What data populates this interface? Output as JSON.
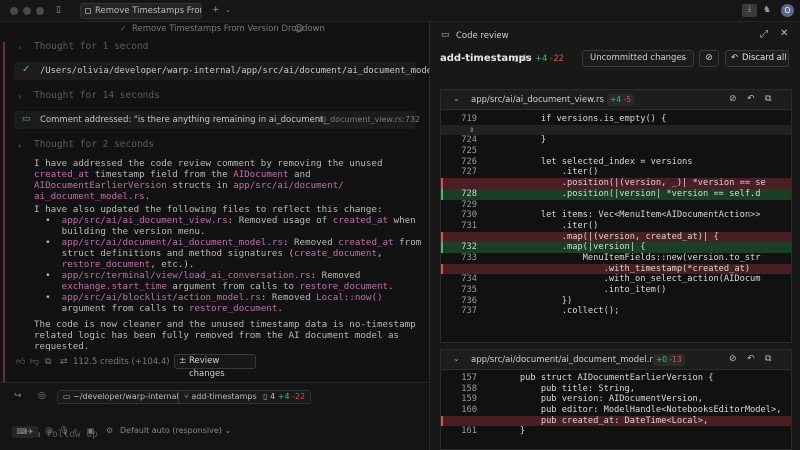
{
  "window": {
    "tab_title": "Remove Timestamps From Ve",
    "subtitle": "Remove Timestamps From Version Dropdown"
  },
  "conversation": {
    "thoughts": [
      "Thought for 1 second",
      "Thought for 14 seconds",
      "Thought for 2 seconds"
    ],
    "tool_path": "/Users/olivia/developer/warp-internal/app/src/ai/document/ai_document_model_tests.rs",
    "comment_addressed": "Comment addressed: \"is there anything remaining in ai_document_",
    "comment_ref": "ai_document_view.rs:732",
    "para1_lines": [
      [
        "I have addressed the code review comment by removing the unused",
        ""
      ],
      [
        "",
        "created_at"
      ],
      [
        " timestamp field from the ",
        ""
      ],
      [
        "",
        "AIDocument"
      ],
      [
        " and",
        ""
      ]
    ],
    "p1_l1": "I have addressed the code review comment by removing the unused",
    "p1_l2a": "created_at",
    "p1_l2b": " timestamp field from the ",
    "p1_l2c": "AIDocument",
    "p1_l2d": " and",
    "p1_l3a": "AIDocumentEarlierVersion",
    "p1_l3b": " structs in ",
    "p1_l3c": "app/src/ai/document/",
    "p1_l4a": "ai_document_model.rs",
    "p1_l4b": ".",
    "p2": "I have also updated the following files to reflect this change:",
    "b1a": "app/src/ai/ai_document_view.rs",
    "b1b": ": Removed usage of ",
    "b1c": "created_at",
    "b1d": " when",
    "b1e": "building the version menu.",
    "b2a": "app/src/ai/document/ai_document_model.rs",
    "b2b": ": Removed ",
    "b2c": "created_at",
    "b2d": " from",
    "b2e": "struct definitions and method signatures (",
    "b2f": "create_document",
    "b2g": ",",
    "b2h": "restore_document",
    "b2i": ", etc.).",
    "b3a": "app/src/terminal/view/load_ai_conversation.rs",
    "b3b": ": Removed",
    "b3c": "exchange.start_time",
    "b3d": " argument from calls to ",
    "b3e": "restore_document",
    "b3f": ".",
    "b4a": "app/src/ai/blocklist/action_model.rs",
    "b4b": ": Removed ",
    "b4c": "Local::now()",
    "b4d": "argument from calls to ",
    "b4e": "restore_document",
    "b4f": ".",
    "p3_l1": "The code is now cleaner and the unused timestamp data is no-timestamp",
    "p3_l2": "related logic has been fully removed from the AI document model as",
    "p3_l3": "requested.",
    "credits": "112.5 credits (+104.4)",
    "review_button": "Review changes"
  },
  "input": {
    "path_chip": "~/developer/warp-internal",
    "branch_chip": "add-timestamps",
    "chip_files": "4",
    "chip_plus": "+4",
    "chip_minus": "-22",
    "placeholder": "Ask a follow up",
    "model_label": "Default",
    "model_mode": "auto (responsive)"
  },
  "code_review": {
    "title": "Code review",
    "branch": "add-timestamps",
    "files_count": "4",
    "plus": "+4",
    "minus": "-22",
    "dropdown": "Uncommitted changes",
    "discard": "Discard all",
    "file1": {
      "path": "app/src/ai/ai_document_view.rs",
      "plus": "+4",
      "minus": "-5",
      "lines": [
        {
          "ln": "719",
          "type": "ctx",
          "code": "        if versions.is_empty() {"
        },
        {
          "ln": "",
          "type": "fold",
          "code": ""
        },
        {
          "ln": "724",
          "type": "ctx",
          "code": "        }"
        },
        {
          "ln": "725",
          "type": "ctx",
          "code": ""
        },
        {
          "ln": "726",
          "type": "ctx",
          "code": "        let selected_index = versions"
        },
        {
          "ln": "727",
          "type": "ctx",
          "code": "            .iter()"
        },
        {
          "ln": "",
          "type": "del",
          "code": "            .position(|(version, _)| *version == se"
        },
        {
          "ln": "728",
          "type": "add",
          "code": "            .position(|version| *version == self.d"
        },
        {
          "ln": "729",
          "type": "ctx",
          "code": ""
        },
        {
          "ln": "730",
          "type": "ctx",
          "code": "        let items: Vec<MenuItem<AIDocumentAction>>"
        },
        {
          "ln": "731",
          "type": "ctx",
          "code": "            .iter()"
        },
        {
          "ln": "",
          "type": "del",
          "code": "            .map(|(version, created_at)| {"
        },
        {
          "ln": "732",
          "type": "add",
          "code": "            .map(|version| {"
        },
        {
          "ln": "733",
          "type": "ctx",
          "code": "                MenuItemFields::new(version.to_str"
        },
        {
          "ln": "",
          "type": "del",
          "code": "                    .with_timestamp(*created_at)"
        },
        {
          "ln": "734",
          "type": "ctx",
          "code": "                    .with_on_select_action(AIDocum"
        },
        {
          "ln": "735",
          "type": "ctx",
          "code": "                    .into_item()"
        },
        {
          "ln": "736",
          "type": "ctx",
          "code": "            })"
        },
        {
          "ln": "737",
          "type": "ctx",
          "code": "            .collect();"
        }
      ]
    },
    "file2": {
      "path": "app/src/ai/document/ai_document_model.rs",
      "plus": "+0",
      "minus": "-13",
      "lines": [
        {
          "ln": "157",
          "type": "ctx",
          "code": "    pub struct AIDocumentEarlierVersion {"
        },
        {
          "ln": "158",
          "type": "ctx",
          "code": "        pub title: String,"
        },
        {
          "ln": "159",
          "type": "ctx",
          "code": "        pub version: AIDocumentVersion,"
        },
        {
          "ln": "160",
          "type": "ctx",
          "code": "        pub editor: ModelHandle<NotebooksEditorModel>,"
        },
        {
          "ln": "",
          "type": "del",
          "code": "        pub created_at: DateTime<Local>,"
        },
        {
          "ln": "161",
          "type": "ctx",
          "code": "    }"
        }
      ]
    }
  }
}
